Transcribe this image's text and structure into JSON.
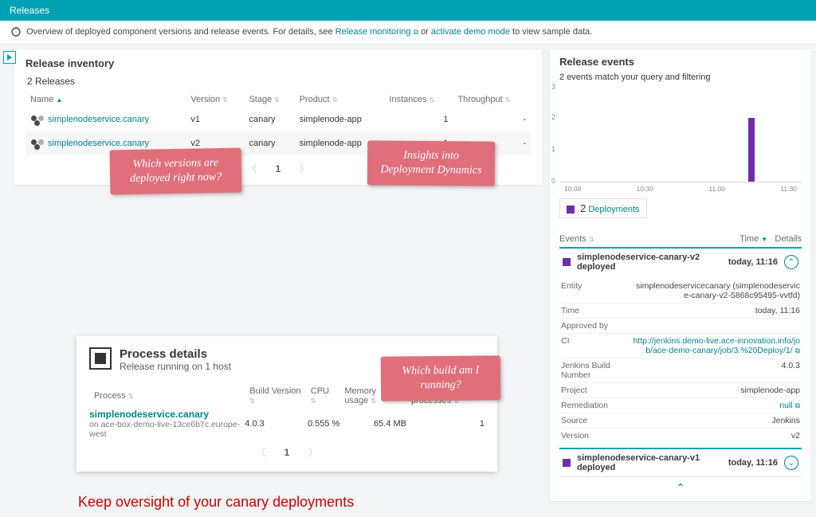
{
  "header": {
    "title": "Releases"
  },
  "info": {
    "text_a": "Overview of deployed component versions and release events. For details, see ",
    "link_monitoring": "Release monitoring",
    "text_b": " or ",
    "link_demo": "activate demo mode",
    "text_c": " to view sample data."
  },
  "inventory": {
    "title": "Release inventory",
    "count_label": "2 Releases",
    "cols": {
      "name": "Name",
      "version": "Version",
      "stage": "Stage",
      "product": "Product",
      "instances": "Instances",
      "throughput": "Throughput"
    },
    "rows": [
      {
        "name": "simplenodeservice.canary",
        "version": "v1",
        "stage": "canary",
        "product": "simplenode-app",
        "instances": "1",
        "throughput": "-"
      },
      {
        "name": "simplenodeservice.canary",
        "version": "v2",
        "stage": "canary",
        "product": "simplenode-app",
        "instances": "1",
        "throughput": "-"
      }
    ],
    "page": "1"
  },
  "callouts": {
    "versions": "Which versions are deployed right now?",
    "dynamics": "Insights into Deployment Dynamics",
    "build": "Which build am I running?"
  },
  "process": {
    "title": "Process details",
    "subtitle": "Release running on 1 host",
    "cols": {
      "process": "Process",
      "build": "Build Version",
      "cpu": "CPU",
      "mem": "Memory usage",
      "workers": "Worker processes"
    },
    "row": {
      "name": "simplenodeservice.canary",
      "host": "on ace-box-demo-live-13ce6b7c.europe-west",
      "build": "4.0.3",
      "cpu": "0.555 %",
      "mem": "65.4 MB",
      "workers": "1"
    },
    "page": "1"
  },
  "slogan": "Keep oversight of your canary deployments",
  "events": {
    "title": "Release events",
    "sub": "2 events match your query and filtering",
    "legend_count": "2",
    "legend_label": "Deployments",
    "table_cols": {
      "events": "Events",
      "time": "Time",
      "details": "Details"
    },
    "rows": [
      {
        "name": "simplenodeservice-canary-v2 deployed",
        "time": "today, 11:16"
      },
      {
        "name": "simplenodeservice-canary-v1 deployed",
        "time": "today, 11:16"
      }
    ],
    "detail": {
      "entity_k": "Entity",
      "entity_v": "simplenodeservicecanary (simplenodeservice-canary-v2-5868c95495-vvtfd)",
      "time_k": "Time",
      "time_v": "today, 11:16",
      "approved_k": "Approved by",
      "approved_v": "",
      "ci_k": "CI",
      "ci_v": "http://jenkins.demo-live.ace-innovation.info/job/ace-demo-canary/job/3.%20Deploy/1/",
      "jbn_k": "Jenkins Build Number",
      "jbn_v": "4.0.3",
      "project_k": "Project",
      "project_v": "simplenode-app",
      "remediation_k": "Remediation",
      "remediation_v": "null",
      "source_k": "Source",
      "source_v": "Jenkins",
      "version_k": "Version",
      "version_v": "v2"
    }
  },
  "chart_data": {
    "type": "bar",
    "categories": [
      "10:00",
      "10:30",
      "11:00",
      "11:30"
    ],
    "series": [
      {
        "name": "Deployments",
        "values": [
          0,
          0,
          2,
          0
        ]
      }
    ],
    "ylim": [
      0,
      3
    ],
    "yticks": [
      0,
      1,
      2,
      3
    ],
    "bar_x_fraction": 0.78
  }
}
